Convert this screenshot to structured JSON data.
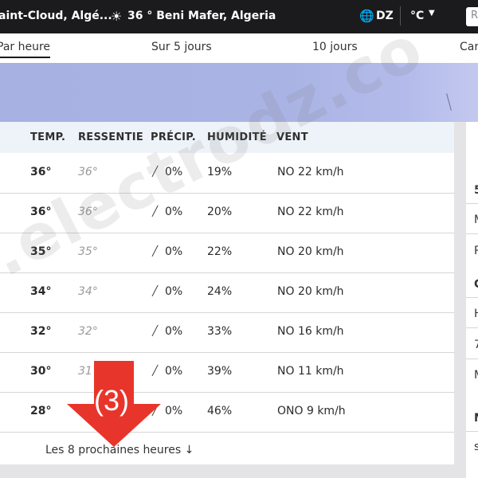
{
  "topbar": {
    "location_1": "aint-Cloud, Algé...",
    "weather_icon": "sun-icon",
    "location_2": "36 ° Beni Mafer, Algeria",
    "globe_icon": "globe-icon",
    "country": "DZ",
    "unit": "°C",
    "search_placeholder": "R"
  },
  "nav": {
    "tabs": [
      {
        "label": "Par heure",
        "active": true
      },
      {
        "label": "Sur 5 jours"
      },
      {
        "label": "10 jours"
      },
      {
        "label": "Car"
      }
    ]
  },
  "table": {
    "headers": [
      "TEMP.",
      "RESSENTIE",
      "PRÉCIP.",
      "HUMIDITÉ",
      "VENT"
    ],
    "rows": [
      {
        "temp": "36°",
        "feel": "36°",
        "precip": "0%",
        "humidity": "19%",
        "wind": "NO 22 km/h"
      },
      {
        "temp": "36°",
        "feel": "36°",
        "precip": "0%",
        "humidity": "20%",
        "wind": "NO 22 km/h"
      },
      {
        "temp": "35°",
        "feel": "35°",
        "precip": "0%",
        "humidity": "22%",
        "wind": "NO 20 km/h"
      },
      {
        "temp": "34°",
        "feel": "34°",
        "precip": "0%",
        "humidity": "24%",
        "wind": "NO 20 km/h"
      },
      {
        "temp": "32°",
        "feel": "32°",
        "precip": "0%",
        "humidity": "33%",
        "wind": "NO 16 km/h"
      },
      {
        "temp": "30°",
        "feel": "31",
        "precip": "0%",
        "humidity": "39%",
        "wind": "NO 11 km/h"
      },
      {
        "temp": "28°",
        "feel": "",
        "precip": "0%",
        "humidity": "46%",
        "wind": "ONO 9 km/h"
      }
    ],
    "more_label": "Les 8 prochaines heures ↓"
  },
  "side": {
    "items": [
      "5",
      "M",
      "R",
      "C",
      "H",
      "7",
      "M",
      "M",
      "s"
    ]
  },
  "watermark": ".electrodz.co",
  "annotation": {
    "label": "(3)",
    "color": "#e8352b"
  },
  "colors": {
    "topbar_bg": "#1b1b1d",
    "header_bg": "#eef3f9",
    "hero": "#a7b2e2"
  }
}
